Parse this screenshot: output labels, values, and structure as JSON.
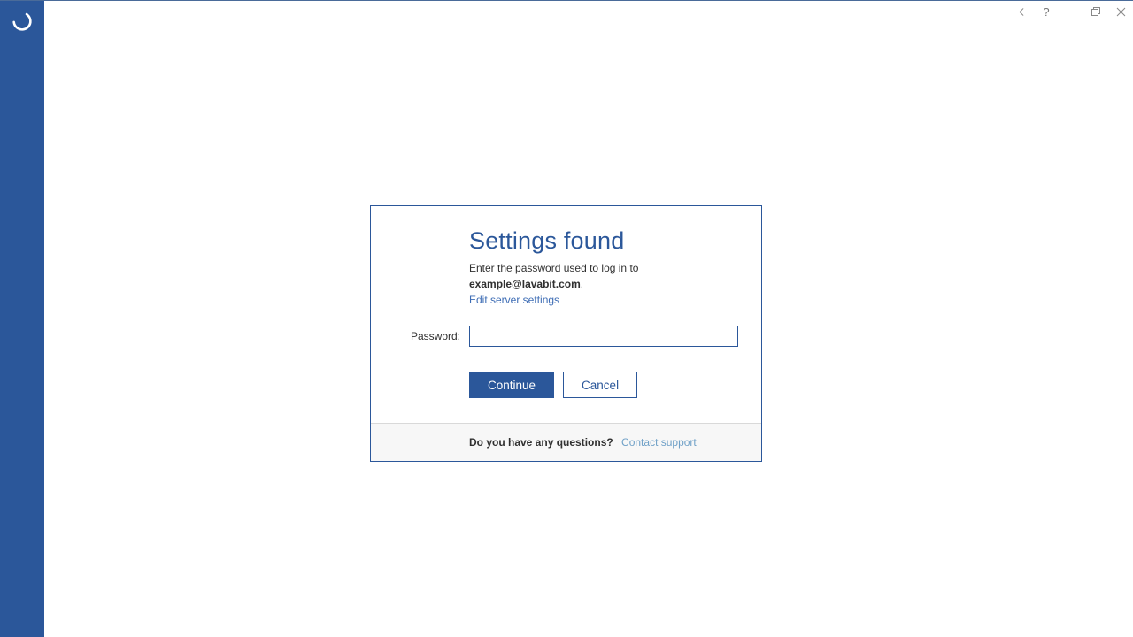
{
  "dialog": {
    "title": "Settings found",
    "subtitle_prefix": "Enter the password used to log in to ",
    "account_email": "example@lavabit.com",
    "subtitle_suffix": ".",
    "edit_link": "Edit server settings",
    "password_label": "Password:",
    "password_value": "",
    "continue_label": "Continue",
    "cancel_label": "Cancel"
  },
  "footer": {
    "question": "Do you have any questions?",
    "support_link": "Contact support"
  },
  "window_controls": {
    "back": "Back",
    "help": "?",
    "minimize": "Minimize",
    "maximize": "Restore",
    "close": "Close"
  }
}
